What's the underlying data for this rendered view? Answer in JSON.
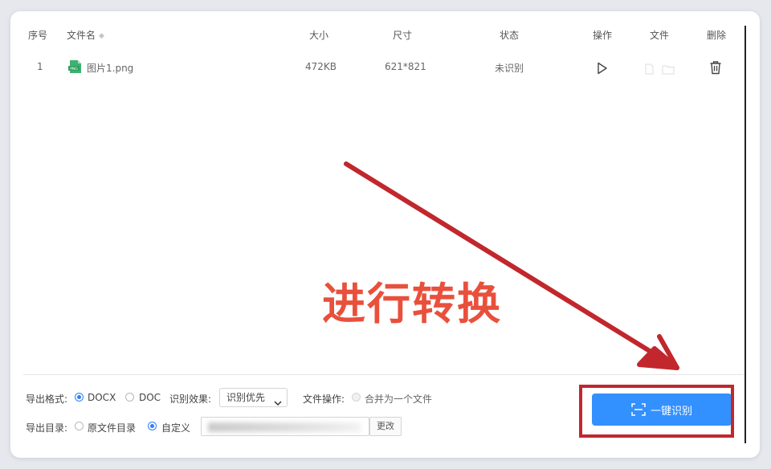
{
  "table": {
    "headers": {
      "index": "序号",
      "filename": "文件名",
      "size": "大小",
      "dimensions": "尺寸",
      "status": "状态",
      "actions": "操作",
      "file": "文件",
      "delete": "删除"
    },
    "rows": [
      {
        "index": "1",
        "filename": "图片1.png",
        "size": "472KB",
        "dimensions": "621*821",
        "status": "未识别"
      }
    ]
  },
  "annotation": {
    "caption": "进行转换",
    "color": "#e9503c",
    "arrow_color": "#c1272d"
  },
  "settings": {
    "export_format_label": "导出格式:",
    "format_options": [
      "DOCX",
      "DOC"
    ],
    "format_selected": "DOCX",
    "ocr_effect_label": "识别效果:",
    "ocr_effect_value": "识别优先",
    "file_ops_label": "文件操作:",
    "merge_option": "合并为一个文件",
    "export_dir_label": "导出目录:",
    "dir_options": [
      "原文件目录",
      "自定义"
    ],
    "dir_selected": "自定义",
    "change_label": "更改"
  },
  "primary_action": {
    "label": "一键识别",
    "color": "#3390ff"
  }
}
